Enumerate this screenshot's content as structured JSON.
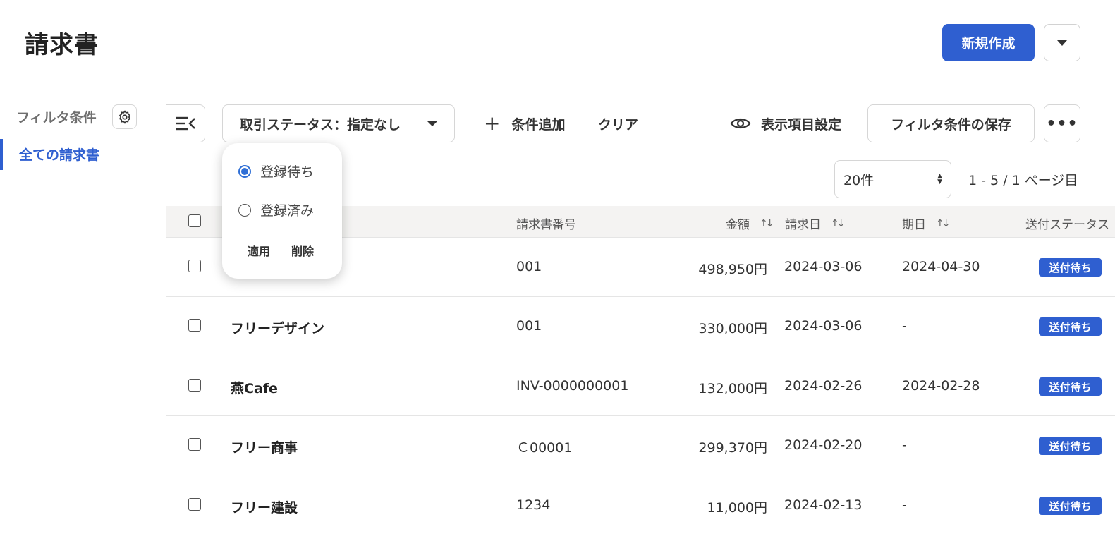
{
  "header": {
    "title": "請求書",
    "create_label": "新規作成"
  },
  "sidebar": {
    "title": "フィルタ条件",
    "items": [
      {
        "label": "全ての請求書"
      }
    ]
  },
  "toolbar": {
    "filter_label": "取引ステータス：指定なし",
    "add_condition": "条件追加",
    "clear": "クリア",
    "display_settings": "表示項目設定",
    "save_filter": "フィルタ条件の保存",
    "more": "•••"
  },
  "pagination": {
    "per_page": "20件",
    "info": "1 - 5 / 1 ページ目"
  },
  "table": {
    "headers": {
      "number": "請求書番号",
      "amount": "金額",
      "issue_date": "請求日",
      "due_date": "期日",
      "send_status": "送付ステータス"
    },
    "rows": [
      {
        "name": "",
        "number": "001",
        "amount": "498,950円",
        "issue_date": "2024-03-06",
        "due_date": "2024-04-30",
        "status": "送付待ち"
      },
      {
        "name": "フリーデザイン",
        "number": "001",
        "amount": "330,000円",
        "issue_date": "2024-03-06",
        "due_date": "-",
        "status": "送付待ち"
      },
      {
        "name": "燕Cafe",
        "number": "INV-0000000001",
        "amount": "132,000円",
        "issue_date": "2024-02-26",
        "due_date": "2024-02-28",
        "status": "送付待ち"
      },
      {
        "name": "フリー商事",
        "number": "Ｃ00001",
        "amount": "299,370円",
        "issue_date": "2024-02-20",
        "due_date": "-",
        "status": "送付待ち"
      },
      {
        "name": "フリー建設",
        "number": "1234",
        "amount": "11,000円",
        "issue_date": "2024-02-13",
        "due_date": "-",
        "status": "送付待ち"
      }
    ]
  },
  "popover": {
    "options": [
      {
        "label": "登録待ち",
        "checked": true
      },
      {
        "label": "登録済み",
        "checked": false
      }
    ],
    "apply": "適用",
    "delete": "削除"
  },
  "colors": {
    "accent": "#2f5fd0",
    "radio_active": "#2f6fd6"
  }
}
